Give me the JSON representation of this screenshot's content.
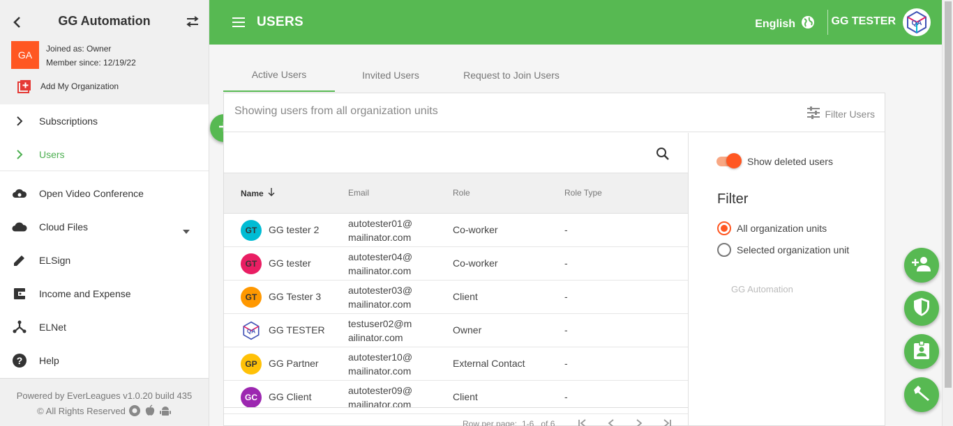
{
  "sidebar": {
    "title": "GG Automation",
    "org_initials": "GA",
    "joined": "Joined as: Owner",
    "member_since": "Member since: 12/19/22",
    "add_org": "Add My Organization",
    "items": [
      {
        "label": "Subscriptions",
        "icon": "chevron-right-icon"
      },
      {
        "label": "Users",
        "icon": "chevron-right-icon",
        "active": true
      },
      {
        "label": "Open Video Conference",
        "icon": "cloud-video-icon"
      },
      {
        "label": "Cloud Files",
        "icon": "cloud-icon"
      },
      {
        "label": "ELSign",
        "icon": "pencil-icon"
      },
      {
        "label": "Income and Expense",
        "icon": "wallet-icon"
      },
      {
        "label": "ELNet",
        "icon": "network-icon"
      },
      {
        "label": "Help",
        "icon": "help-icon"
      }
    ],
    "footer_line1": "Powered by EverLeagues v1.0.20 build 435",
    "footer_line2": "© All Rights Reserved"
  },
  "topbar": {
    "title": "USERS",
    "language": "English",
    "user_name": "GG TESTER",
    "accent": "#57b952"
  },
  "tabs": [
    "Active Users",
    "Invited Users",
    "Request to Join Users"
  ],
  "panel": {
    "showing": "Showing users from all organization units",
    "filter_users": "Filter Users"
  },
  "table": {
    "headers": {
      "name": "Name",
      "email": "Email",
      "role": "Role",
      "role_type": "Role Type"
    },
    "rows": [
      {
        "initials": "GT",
        "color": "#00bcd4",
        "name": "GG tester 2",
        "email_1": "autotester01@",
        "email_2": "mailinator.com",
        "role": "Co-worker",
        "role_type": "-"
      },
      {
        "initials": "GT",
        "color": "#e91e63",
        "name": "GG tester",
        "email_1": "autotester04@",
        "email_2": "mailinator.com",
        "role": "Co-worker",
        "role_type": "-"
      },
      {
        "initials": "GT",
        "color": "#ff9800",
        "name": "GG Tester 3",
        "email_1": "autotester03@",
        "email_2": "mailinator.com",
        "role": "Client",
        "role_type": "-"
      },
      {
        "initials": "",
        "color": "#ffffff",
        "name": "GG TESTER",
        "email_1": "testuser02@m",
        "email_2": "ailinator.com",
        "role": "Owner",
        "role_type": "-"
      },
      {
        "initials": "GP",
        "color": "#ffc107",
        "name": "GG Partner",
        "email_1": "autotester10@",
        "email_2": "mailinator.com",
        "role": "External Contact",
        "role_type": "-"
      },
      {
        "initials": "GC",
        "color": "#9c27b0",
        "name": "GG Client",
        "email_1": "autotester09@",
        "email_2": "mailinator.com",
        "role": "Client",
        "role_type": "-"
      }
    ],
    "pager_label": "Row per page:",
    "pager_range": "1-6   of 6"
  },
  "filter": {
    "show_deleted": "Show deleted users",
    "title": "Filter",
    "options": [
      "All organization units",
      "Selected organization unit"
    ],
    "selected": "All organization units",
    "org_unit": "GG Automation"
  }
}
